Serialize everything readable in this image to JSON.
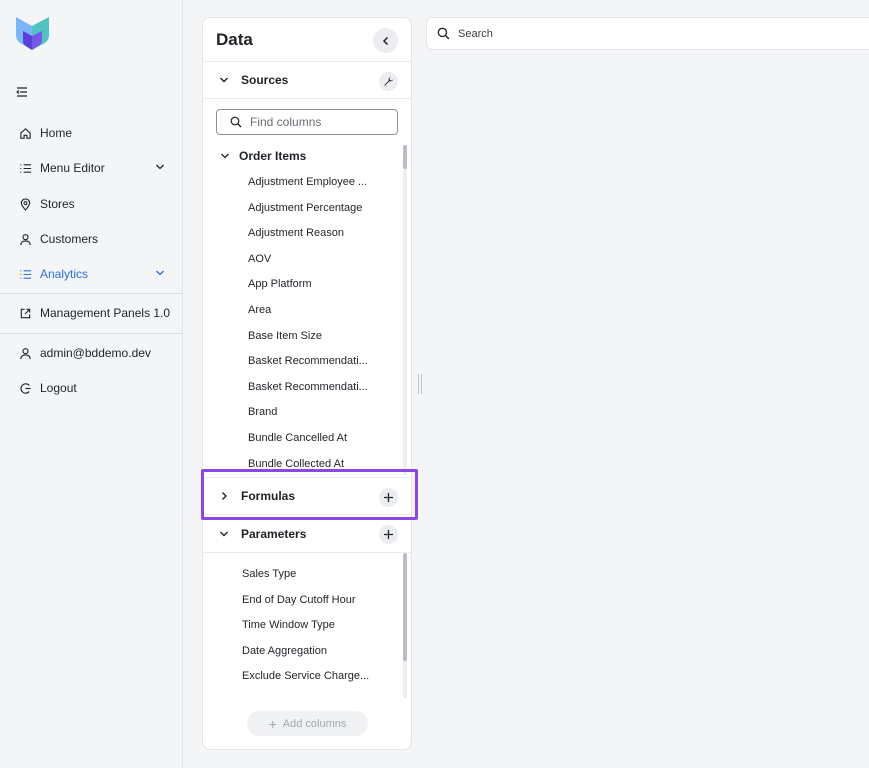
{
  "colors": {
    "accent": "#2b6ee0",
    "highlight": "#8a47e6",
    "logo_light": "#7ab6f8",
    "logo_dark": "#5a3fd8"
  },
  "nav": {
    "items": [
      {
        "label": "Home",
        "icon": "home-icon"
      },
      {
        "label": "Menu Editor",
        "icon": "list-icon"
      },
      {
        "label": "Stores",
        "icon": "location-pin-icon"
      },
      {
        "label": "Customers",
        "icon": "user-icon"
      },
      {
        "label": "Analytics",
        "icon": "list-icon"
      }
    ],
    "management": "Management Panels 1.0",
    "user": "admin@bddemo.dev",
    "logout": "Logout"
  },
  "panel": {
    "title": "Data",
    "sources_label": "Sources",
    "find_placeholder": "Find columns",
    "group_label": "Order Items",
    "columns": [
      "Adjustment Employee ...",
      "Adjustment Percentage",
      "Adjustment Reason",
      "AOV",
      "App Platform",
      "Area",
      "Base Item Size",
      "Basket Recommendati...",
      "Basket Recommendati...",
      "Brand",
      "Bundle Cancelled At",
      "Bundle Collected At"
    ],
    "formulas_label": "Formulas",
    "parameters_label": "Parameters",
    "parameters": [
      "Sales Type",
      "End of Day Cutoff Hour",
      "Time Window Type",
      "Date Aggregation",
      "Exclude Service Charge..."
    ],
    "add_columns_label": "Add columns"
  },
  "search": {
    "placeholder": "Search"
  }
}
